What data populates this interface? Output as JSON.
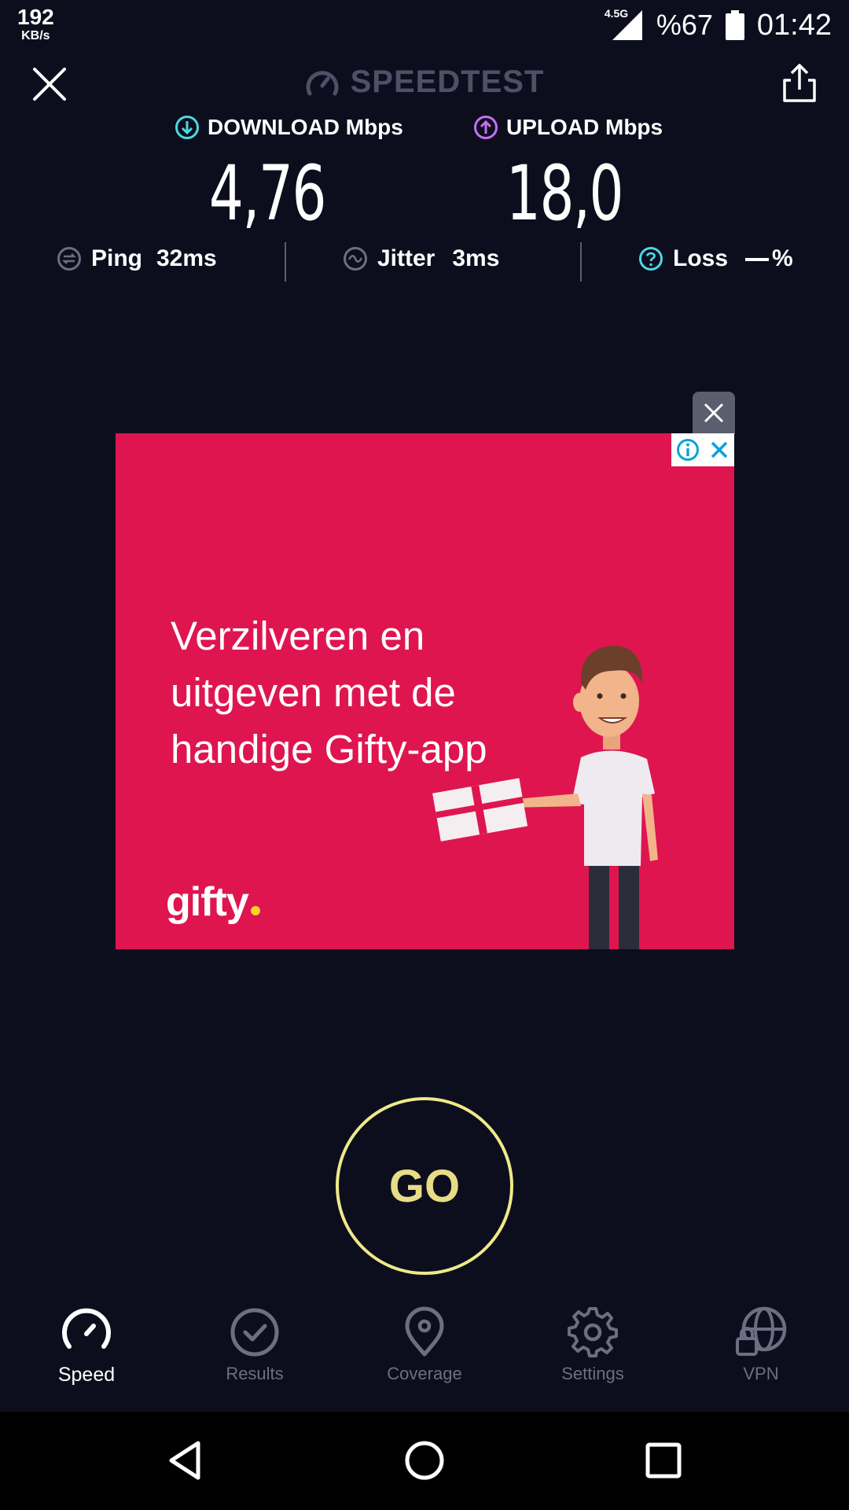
{
  "status_bar": {
    "net_speed_value": "192",
    "net_speed_unit": "KB/s",
    "network_type": "4.5G",
    "battery_percent": "%67",
    "time": "01:42"
  },
  "header": {
    "title": "SPEEDTEST",
    "close_icon": "close-icon",
    "share_icon": "share-icon"
  },
  "results": {
    "download_label": "DOWNLOAD Mbps",
    "download_value": "4,76",
    "upload_label": "UPLOAD Mbps",
    "upload_value": "18,0",
    "ping_label": "Ping",
    "ping_value": "32ms",
    "jitter_label": "Jitter",
    "jitter_value": "3ms",
    "loss_label": "Loss",
    "loss_unit": "%"
  },
  "ad": {
    "headline_line1": "Verzilveren en",
    "headline_line2": "uitgeven met de",
    "headline_line3": "handige Gifty-app",
    "brand": "gifty",
    "background_color": "#df1550"
  },
  "go_button": {
    "label": "GO",
    "color": "#efe98a"
  },
  "bottom_nav": {
    "items": [
      {
        "label": "Speed",
        "icon": "speed-gauge-icon",
        "active": true
      },
      {
        "label": "Results",
        "icon": "checkmark-circle-icon",
        "active": false
      },
      {
        "label": "Coverage",
        "icon": "map-pin-icon",
        "active": false
      },
      {
        "label": "Settings",
        "icon": "gear-icon",
        "active": false
      },
      {
        "label": "VPN",
        "icon": "globe-lock-icon",
        "active": false
      }
    ]
  },
  "android_nav": {
    "back": "back-icon",
    "home": "home-icon",
    "recents": "recents-icon"
  },
  "colors": {
    "background": "#0d0e1d",
    "download_accent": "#4fd6e4",
    "upload_accent": "#c56ff2",
    "muted": "#6c6e82"
  }
}
